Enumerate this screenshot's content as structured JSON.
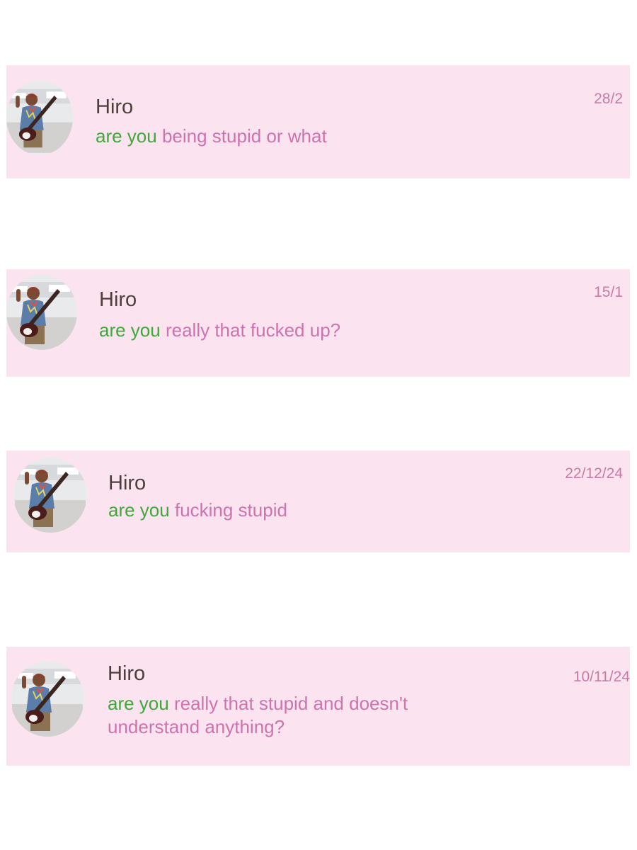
{
  "colors": {
    "card_background": "#fbe4ef",
    "name": "#4e3e3b",
    "message": "#cd73ad",
    "message_lead": "#3fa83a",
    "date": "#c97ba8"
  },
  "messages": [
    {
      "sender": "Hiro",
      "lead": "are you",
      "text": " being stupid or what",
      "date": "28/2",
      "avatar": "profile-photo"
    },
    {
      "sender": "Hiro",
      "lead": "are you",
      "text": " really that fucked up?",
      "date": "15/1",
      "avatar": "profile-photo"
    },
    {
      "sender": "Hiro",
      "lead": "are you",
      "text": " fucking stupid",
      "date": "22/12/24",
      "avatar": "profile-photo"
    },
    {
      "sender": "Hiro",
      "lead": "are you",
      "text": " really that stupid and doesn't understand anything?",
      "date": "10/11/24",
      "avatar": "profile-photo"
    }
  ]
}
